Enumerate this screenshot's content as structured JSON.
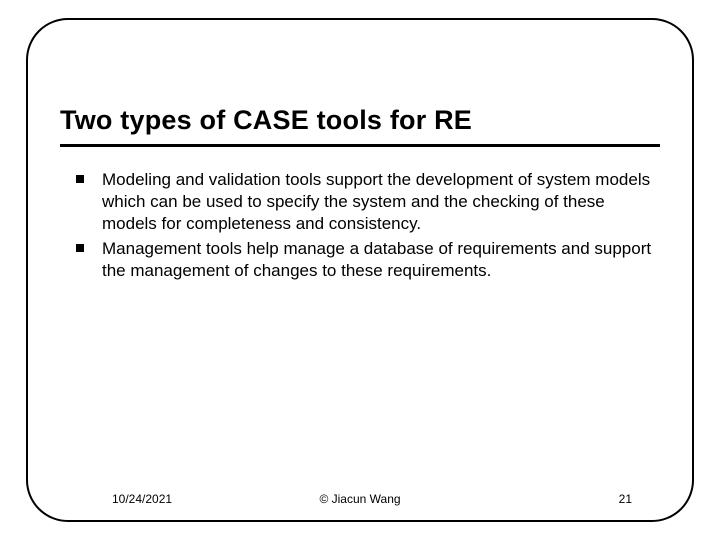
{
  "slide": {
    "title": "Two types of CASE tools for RE",
    "bullets": [
      "Modeling and validation tools support the development of system models which can be used to specify the system and the checking of these models for completeness and consistency.",
      "Management tools help manage a database of requirements and support the management of changes to these requirements."
    ],
    "footer": {
      "date": "10/24/2021",
      "copyright": "© Jiacun Wang",
      "page": "21"
    }
  }
}
